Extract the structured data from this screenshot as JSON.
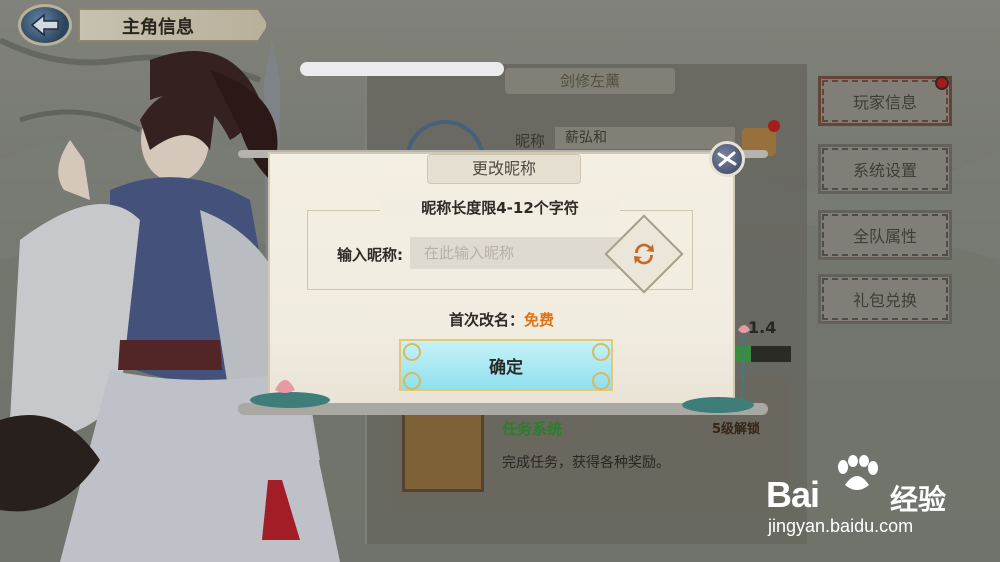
{
  "header": {
    "title": "主角信息"
  },
  "background_panel": {
    "header": "剑修左薰",
    "nickname_label": "昵称",
    "nickname_value": "薪弘和",
    "level_text": "1.4",
    "exp_progress": 0.28,
    "task": {
      "title": "任务系统",
      "description": "完成任务，获得各种奖励。",
      "unlock": "5级解锁"
    }
  },
  "side_menu": {
    "items": [
      {
        "label": "玩家信息"
      },
      {
        "label": "系统设置"
      },
      {
        "label": "全队属性"
      },
      {
        "label": "礼包兑换"
      }
    ]
  },
  "modal": {
    "title": "更改昵称",
    "limit_text": "昵称长度限4-12个字符",
    "input_label": "输入昵称:",
    "input_placeholder": "在此输入昵称",
    "input_value": "",
    "rename_label": "首次改名：",
    "rename_value": "免费",
    "confirm_label": "确定"
  },
  "watermark": {
    "brand": "Bai",
    "brand_cn": "经验",
    "url": "jingyan.baidu.com"
  },
  "colors": {
    "accent_orange": "#e07414",
    "task_green": "#2f8a2f",
    "confirm_cyan": "#8fe0ee",
    "notify_red": "#b61e1e"
  }
}
